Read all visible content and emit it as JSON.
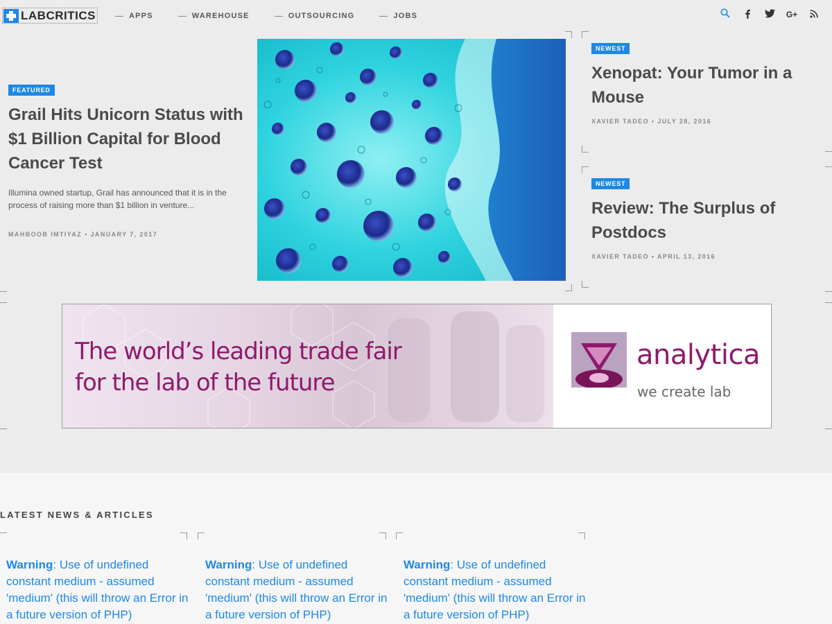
{
  "header": {
    "logo_text": "LABCRITICS",
    "nav": [
      "APPS",
      "WAREHOUSE",
      "OUTSOURCING",
      "JOBS"
    ],
    "icons": [
      {
        "name": "search-icon",
        "glyph": "⌕"
      },
      {
        "name": "facebook-icon",
        "glyph": "f"
      },
      {
        "name": "twitter-icon",
        "glyph": "t"
      },
      {
        "name": "google-plus-icon",
        "glyph": "G+"
      },
      {
        "name": "rss-icon",
        "glyph": "⦿"
      }
    ]
  },
  "featured": {
    "badge": "FEATURED",
    "title": "Grail Hits Unicorn Status with $1 Billion Capital for Blood Cancer Test",
    "excerpt": "Illumina owned startup, Grail has announced that it is in the process of raising more than $1 billion in venture...",
    "meta": "MAHBOOB IMTIYAZ • JANUARY 7, 2017"
  },
  "side_articles": [
    {
      "badge": "NEWEST",
      "title": "Xenopat: Your Tumor in a Mouse",
      "meta": "XAVIER TADEO • JULY 28, 2016"
    },
    {
      "badge": "NEWEST",
      "title": "Review: The Surplus of Postdocs",
      "meta": "XAVIER TADEO • APRIL 13, 2016"
    }
  ],
  "banner": {
    "line1": "The world’s leading trade fair",
    "line2": "for the lab of the future",
    "brand": "analytica",
    "tagline": "we create lab"
  },
  "latest": {
    "heading": "LATEST NEWS & ARTICLES",
    "warnings": [
      {
        "label": "Warning",
        "text": ": Use of undefined constant medium - assumed 'medium' (this will throw an Error in a future version of PHP)"
      },
      {
        "label": "Warning",
        "text": ": Use of undefined constant medium - assumed 'medium' (this will throw an Error in a future version of PHP)"
      },
      {
        "label": "Warning",
        "text": ": Use of undefined constant medium - assumed 'medium' (this will throw an Error in a future version of PHP)"
      }
    ]
  },
  "colors": {
    "accent": "#1e88e5",
    "brand_purple": "#8e1a6a",
    "background": "#ececec"
  }
}
